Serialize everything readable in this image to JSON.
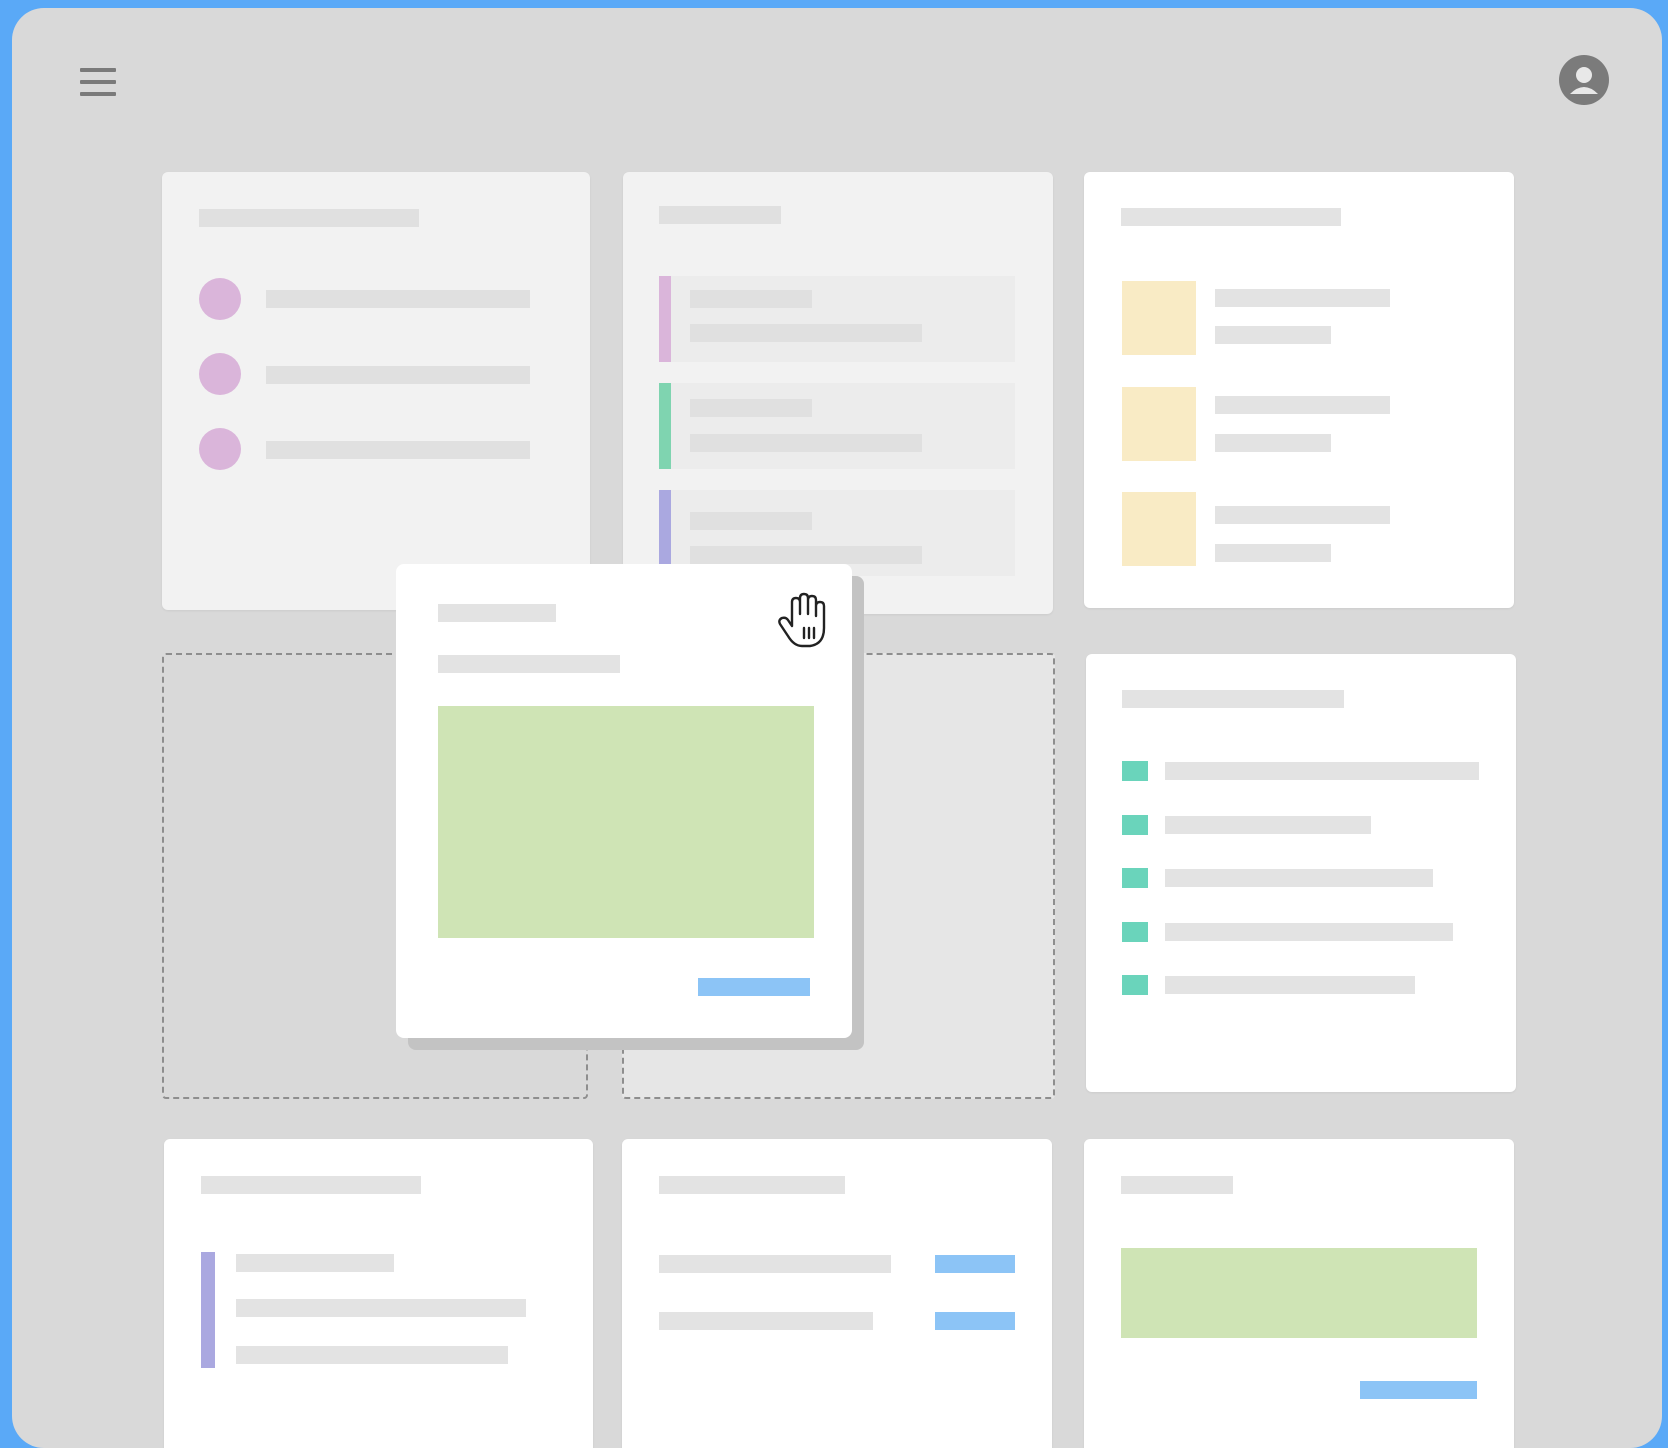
{
  "header": {
    "menu_icon": "hamburger-menu-icon",
    "profile_icon": "user-avatar-icon"
  },
  "colors": {
    "frame": "#5aa9f7",
    "background": "#d9d9d9",
    "placeholder_bar": "#e3e3e3",
    "pink": "#dab5da",
    "green_accent": "#7fd4b0",
    "purple_accent": "#aaa8e0",
    "yellow": "#f9ebc5",
    "teal": "#6ad4bb",
    "blue": "#8cc4f6",
    "light_green": "#cfe4b5"
  },
  "cards": [
    {
      "id": "avatar-list-card",
      "type": "avatar-list",
      "items": 3
    },
    {
      "id": "accent-list-card",
      "type": "accent-list",
      "items": 3
    },
    {
      "id": "thumbnail-list-card",
      "type": "thumbnail-list",
      "items": 3
    },
    {
      "id": "drop-slot",
      "type": "empty-slot"
    },
    {
      "id": "checklist-card",
      "type": "checklist",
      "items": 5
    },
    {
      "id": "quote-card",
      "type": "accent-text"
    },
    {
      "id": "values-card",
      "type": "label-value",
      "items": 2
    },
    {
      "id": "image-action-card",
      "type": "image-action"
    }
  ],
  "dragging": {
    "card": "image-action-card",
    "cursor_icon": "grab-hand-cursor-icon"
  }
}
